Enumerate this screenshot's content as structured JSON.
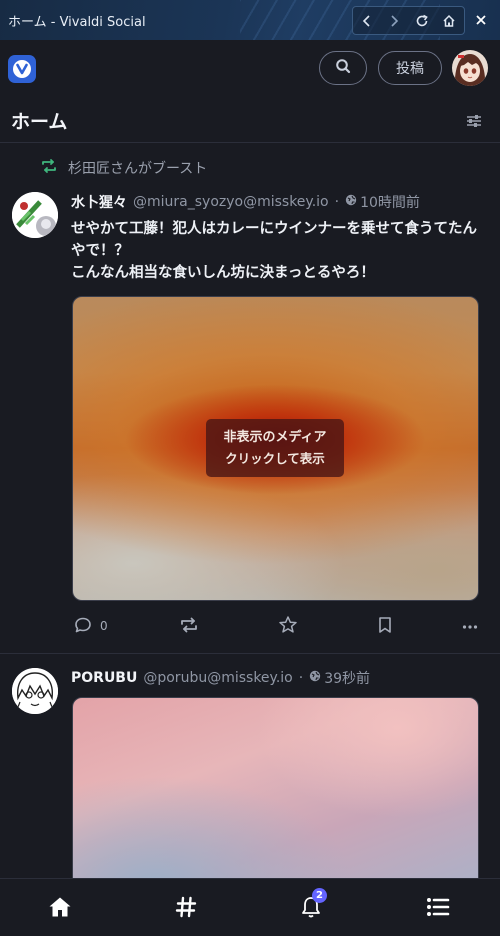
{
  "window": {
    "title": "ホーム - Vivaldi Social"
  },
  "header": {
    "post_label": "投稿"
  },
  "column": {
    "title": "ホーム"
  },
  "boost": {
    "text": "杉田匠さんがブースト"
  },
  "posts": [
    {
      "display_name": "水卜猩々",
      "account": "@miura_syozyo@misskey.io",
      "separator": "·",
      "time": "10時間前",
      "lines": [
        "せやかて工藤！犯人はカレーにウインナーを乗せて食うてたん",
        "やで！？",
        "こんなん相当な食いしん坊に決まっとるやろ！"
      ],
      "media_hidden": {
        "line1": "非表示のメディア",
        "line2": "クリックして表示"
      },
      "reply_count": "0"
    },
    {
      "display_name": "PORUBU",
      "account": "@porubu@misskey.io",
      "separator": "·",
      "time": "39秒前"
    }
  ],
  "bottom_nav": {
    "notification_badge": "2"
  },
  "colors": {
    "background": "#191b22",
    "accent": "#6364ff",
    "boost_green": "#3fb67d",
    "logo_blue": "#2f62d6"
  }
}
